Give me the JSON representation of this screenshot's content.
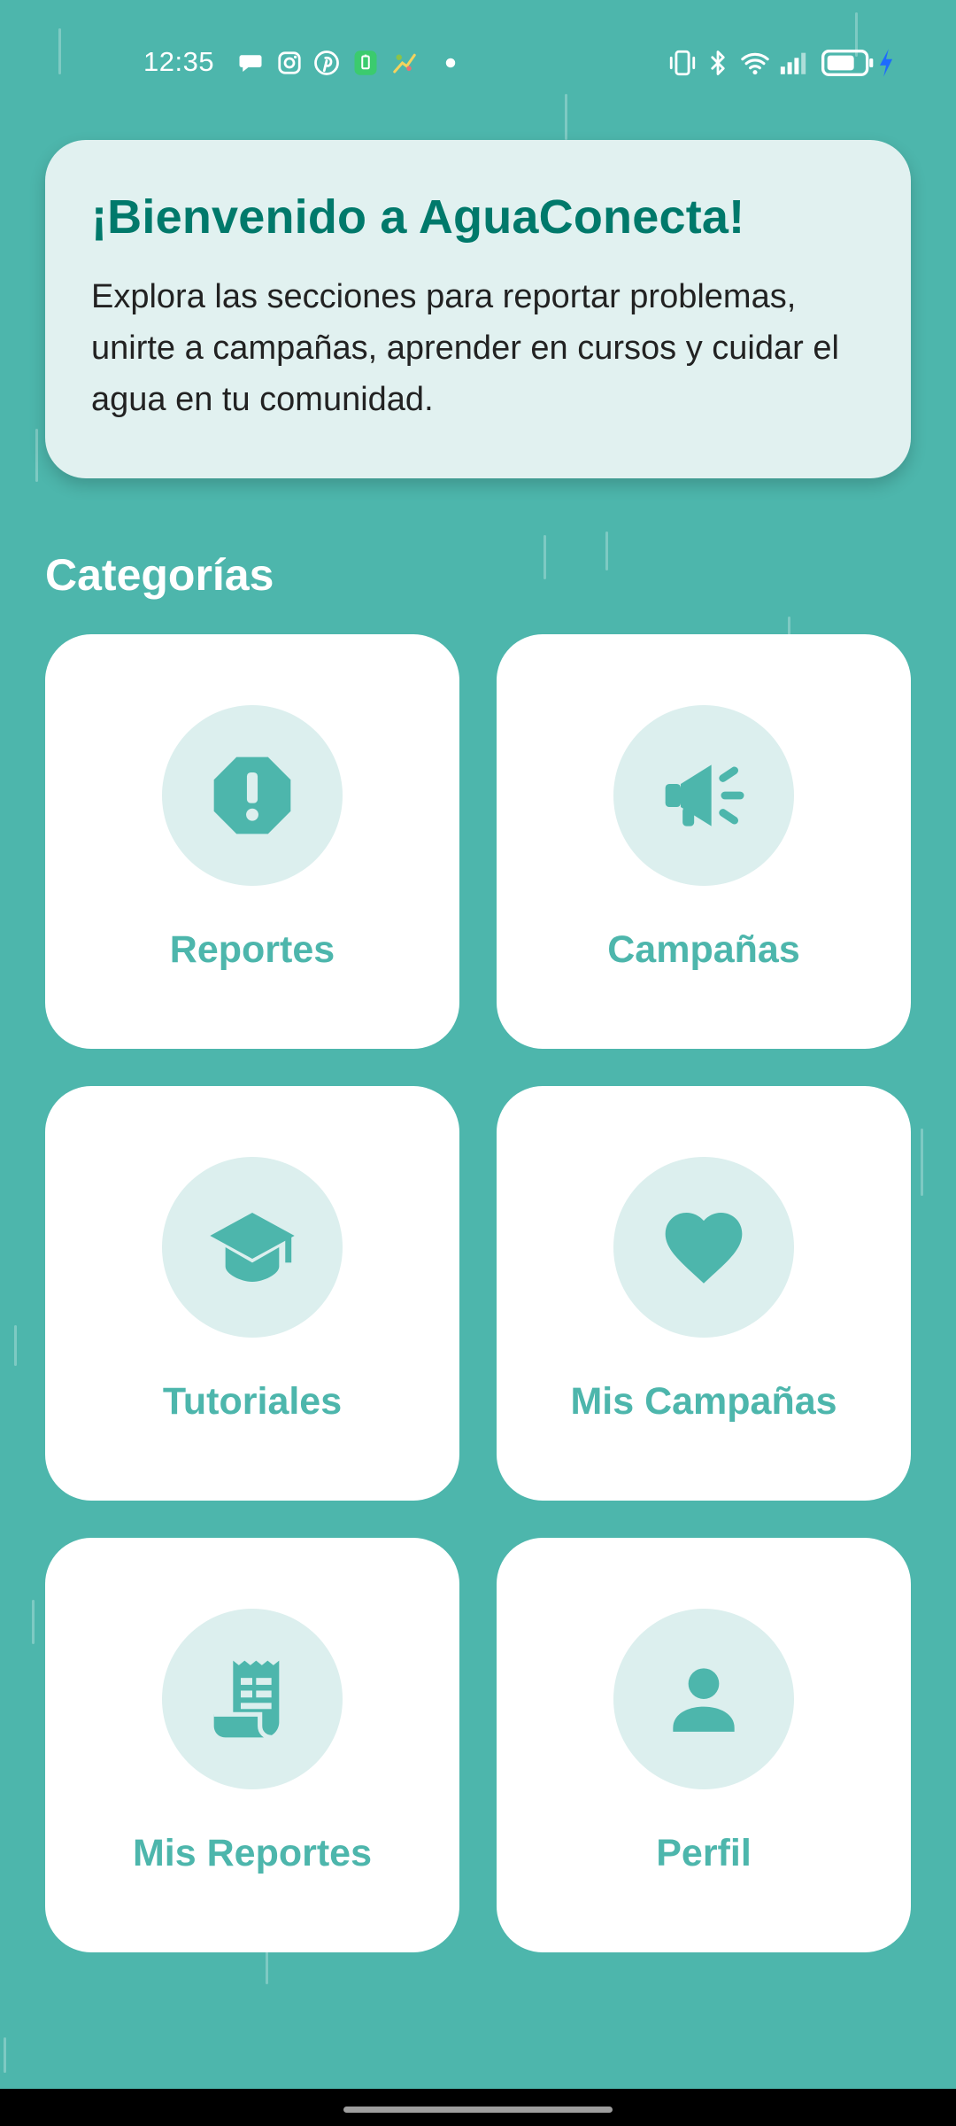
{
  "status_bar": {
    "time": "12:35",
    "left_icons": [
      "chat-bubble-icon",
      "instagram-icon",
      "pinterest-icon",
      "battery-app-icon",
      "game-app-icon",
      "dot-icon"
    ],
    "right_icons": [
      "vibrate-icon",
      "bluetooth-icon",
      "wifi-icon",
      "signal-icon",
      "battery-icon",
      "charging-icon"
    ]
  },
  "welcome": {
    "title": "¡Bienvenido a AguaConecta!",
    "body": "Explora las secciones para reportar problemas, unirte a campañas, aprender en cursos y cuidar el agua en tu comunidad."
  },
  "section_title": "Categorías",
  "categories": [
    {
      "label": "Reportes",
      "icon": "report-alert-icon"
    },
    {
      "label": "Campañas",
      "icon": "megaphone-icon"
    },
    {
      "label": "Tutoriales",
      "icon": "graduation-cap-icon"
    },
    {
      "label": "Mis Campañas",
      "icon": "heart-icon"
    },
    {
      "label": "Mis Reportes",
      "icon": "receipt-icon"
    },
    {
      "label": "Perfil",
      "icon": "person-icon"
    }
  ],
  "colors": {
    "background": "#4DB6AC",
    "accent": "#00796B",
    "tile_label": "#4DB6AC",
    "icon_circle": "#DCEFEE",
    "welcome_card": "#E1F1F0"
  }
}
